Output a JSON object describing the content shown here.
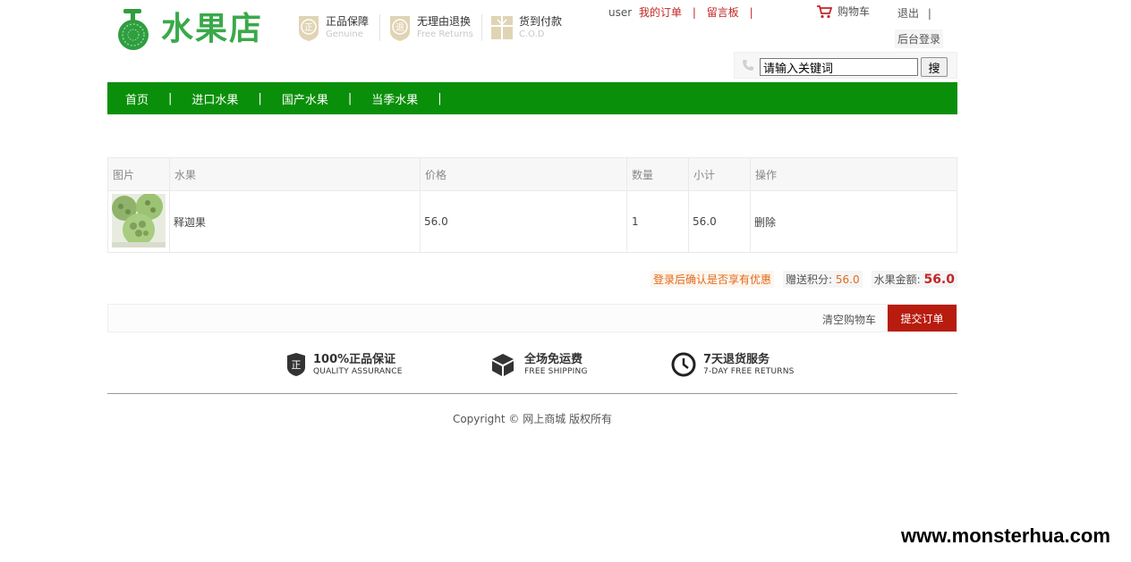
{
  "brand": {
    "name": "水果店",
    "color": "#3aa94a"
  },
  "guarantees": [
    {
      "title": "正品保障",
      "subtitle": "Genuine",
      "icon": "genuine-shield-icon",
      "glyph": "正"
    },
    {
      "title": "无理由退换",
      "subtitle": "Free Returns",
      "icon": "returns-shield-icon",
      "glyph": "退"
    },
    {
      "title": "货到付款",
      "subtitle": "C.O.D",
      "icon": "cod-icon",
      "glyph": ""
    }
  ],
  "topbar": {
    "user": "user",
    "my_orders": "我的订单",
    "sep": "|",
    "guestbook": "留言板",
    "cart": "购物车",
    "logout": "退出",
    "admin": "后台登录"
  },
  "search": {
    "value": "请输入关键词",
    "button": "搜"
  },
  "nav": {
    "items": [
      "首页",
      "进口水果",
      "国产水果",
      "当季水果"
    ],
    "sep": "|",
    "color": "#0a8f0a"
  },
  "cart_table": {
    "headers": [
      "图片",
      "水果",
      "价格",
      "数量",
      "小计",
      "操作"
    ],
    "rows": [
      {
        "image": "custard-apple-image",
        "name": "释迦果",
        "price": "56.0",
        "qty": "1",
        "subtotal": "56.0",
        "action": "删除"
      }
    ]
  },
  "summary": {
    "login_tip": "登录后确认是否享有优惠",
    "points_label": "赠送积分:",
    "points_value": "56.0",
    "total_label": "水果金额:",
    "total_value": "56.0"
  },
  "actions": {
    "clear": "清空购物车",
    "submit": "提交订单",
    "submit_color": "#b81c0f"
  },
  "services": [
    {
      "title": "100%正品保证",
      "subtitle": "QUALITY ASSURANCE",
      "icon": "quality-badge-icon",
      "glyph": "正"
    },
    {
      "title": "全场免运费",
      "subtitle": "FREE SHIPPING",
      "icon": "box-icon"
    },
    {
      "title": "7天退货服务",
      "subtitle": "7-DAY FREE RETURNS",
      "icon": "clock-icon"
    }
  ],
  "footer": {
    "copyright": "Copyright © 网上商城 版权所有"
  },
  "watermark": "www.monsterhua.com"
}
